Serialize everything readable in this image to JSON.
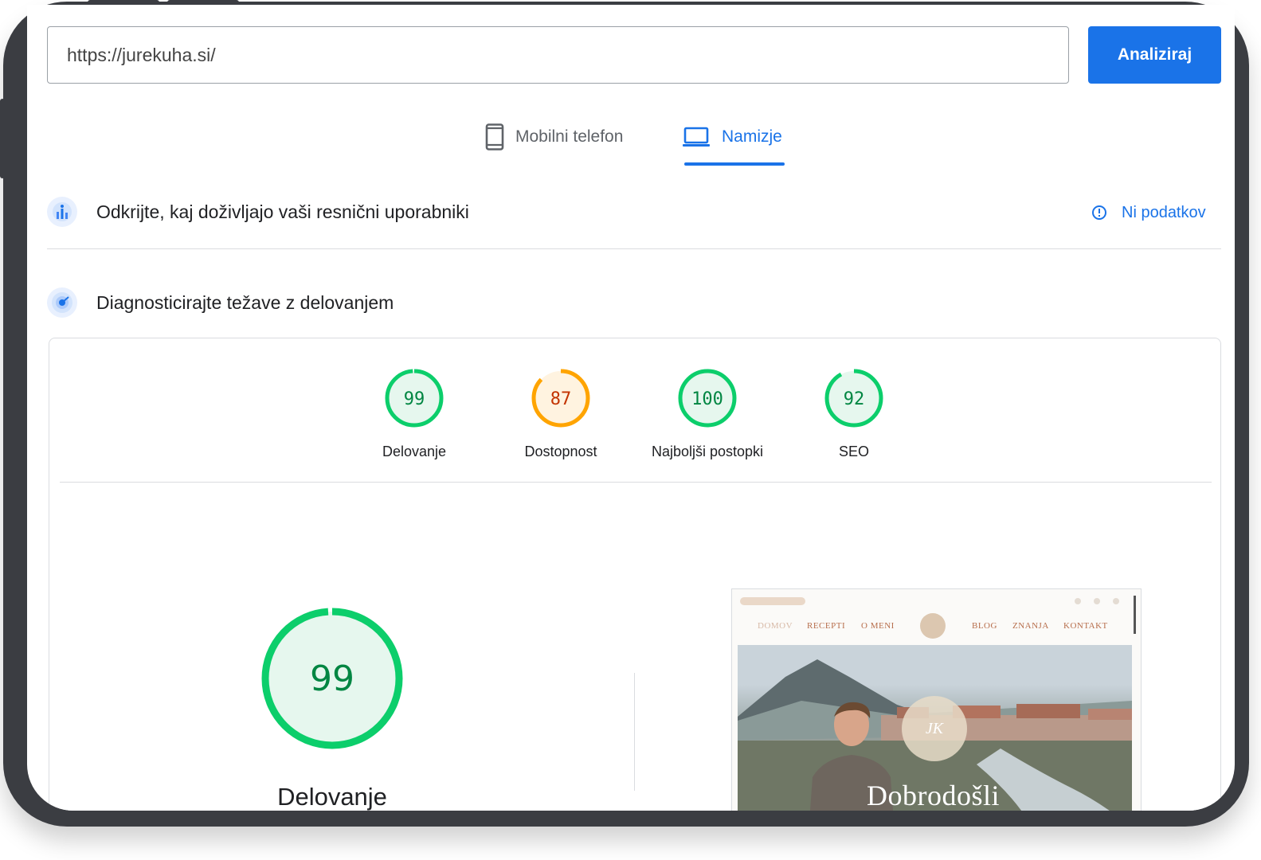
{
  "url_bar": {
    "value": "https://jurekuha.si/",
    "analyze_label": "Analiziraj"
  },
  "tabs": [
    {
      "label": "Mobilni telefon",
      "icon": "smartphone-icon",
      "active": false
    },
    {
      "label": "Namizje",
      "icon": "laptop-icon",
      "active": true
    }
  ],
  "field_data": {
    "title": "Odkrijte, kaj doživljajo vaši resnični uporabniki",
    "status_label": "Ni podatkov",
    "status_icon": "info-icon"
  },
  "lab_data": {
    "title": "Diagnosticirajte težave z delovanjem"
  },
  "scores": [
    {
      "label": "Delovanje",
      "value": "99",
      "fraction": 0.99,
      "color": "#0cce6b",
      "text_color": "#018642",
      "bg": "#e6f7ee"
    },
    {
      "label": "Dostopnost",
      "value": "87",
      "fraction": 0.87,
      "color": "#ffa400",
      "text_color": "#c33300",
      "bg": "#fff3e0"
    },
    {
      "label": "Najboljši postopki",
      "value": "100",
      "fraction": 1.0,
      "color": "#0cce6b",
      "text_color": "#018642",
      "bg": "#e6f7ee"
    },
    {
      "label": "SEO",
      "value": "92",
      "fraction": 0.92,
      "color": "#0cce6b",
      "text_color": "#018642",
      "bg": "#e6f7ee"
    }
  ],
  "main_score": {
    "label": "Delovanje",
    "value": "99",
    "fraction": 0.99,
    "color": "#0cce6b"
  },
  "screenshot": {
    "nav": [
      "DOMOV",
      "RECEPTI",
      "O MENI",
      "BLOG",
      "ZNANJA",
      "KONTAKT"
    ],
    "hero_text": "Dobrodošli"
  }
}
